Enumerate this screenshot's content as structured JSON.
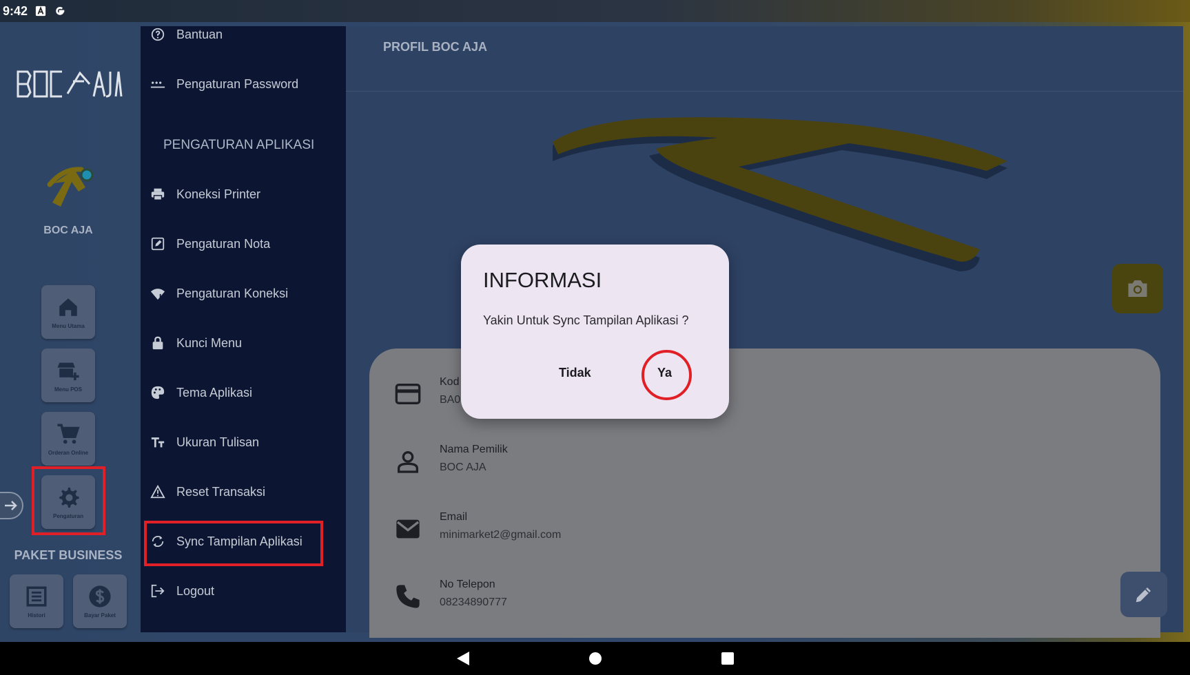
{
  "status_bar": {
    "time": "9:42"
  },
  "rail": {
    "store_name": "BOC AJA",
    "buttons": [
      {
        "label": "Menu Utama",
        "icon": "home-icon"
      },
      {
        "label": "Menu POS",
        "icon": "store-add-icon"
      },
      {
        "label": "Orderan Online",
        "icon": "cart-icon"
      },
      {
        "label": "Pengaturan",
        "icon": "gear-icon"
      }
    ],
    "paket_label": "PAKET BUSINESS",
    "bottom_buttons": [
      {
        "label": "Histori",
        "icon": "list-icon"
      },
      {
        "label": "Bayar Paket",
        "icon": "dollar-icon"
      }
    ]
  },
  "drawer": {
    "top_items": [
      {
        "label": "Bantuan",
        "icon": "help-icon"
      },
      {
        "label": "Pengaturan Password",
        "icon": "password-icon"
      }
    ],
    "section_title": "PENGATURAN APLIKASI",
    "items": [
      {
        "label": "Koneksi Printer",
        "icon": "printer-icon"
      },
      {
        "label": "Pengaturan Nota",
        "icon": "note-edit-icon"
      },
      {
        "label": "Pengaturan Koneksi",
        "icon": "wifi-icon"
      },
      {
        "label": "Kunci Menu",
        "icon": "lock-icon"
      },
      {
        "label": "Tema Aplikasi",
        "icon": "palette-icon"
      },
      {
        "label": "Ukuran Tulisan",
        "icon": "text-size-icon"
      },
      {
        "label": "Reset Transaksi",
        "icon": "warning-icon"
      },
      {
        "label": "Sync Tampilan Aplikasi",
        "icon": "sync-icon"
      },
      {
        "label": "Logout",
        "icon": "logout-icon"
      }
    ]
  },
  "main": {
    "title": "PROFIL BOC AJA",
    "fields": [
      {
        "key": "Kod",
        "value": "BA0",
        "icon": "card-icon"
      },
      {
        "key": "Nama Pemilik",
        "value": "BOC AJA",
        "icon": "person-icon"
      },
      {
        "key": "Email",
        "value": "minimarket2@gmail.com",
        "icon": "mail-icon"
      },
      {
        "key": "No Telepon",
        "value": "08234890777",
        "icon": "phone-icon"
      }
    ]
  },
  "dialog": {
    "title": "INFORMASI",
    "message": "Yakin Untuk Sync Tampilan Aplikasi ?",
    "cancel_label": "Tidak",
    "confirm_label": "Ya"
  },
  "colors": {
    "accent_yellow": "#4a440f",
    "drawer_bg": "#0c1633",
    "highlight_red": "#e01f26"
  }
}
